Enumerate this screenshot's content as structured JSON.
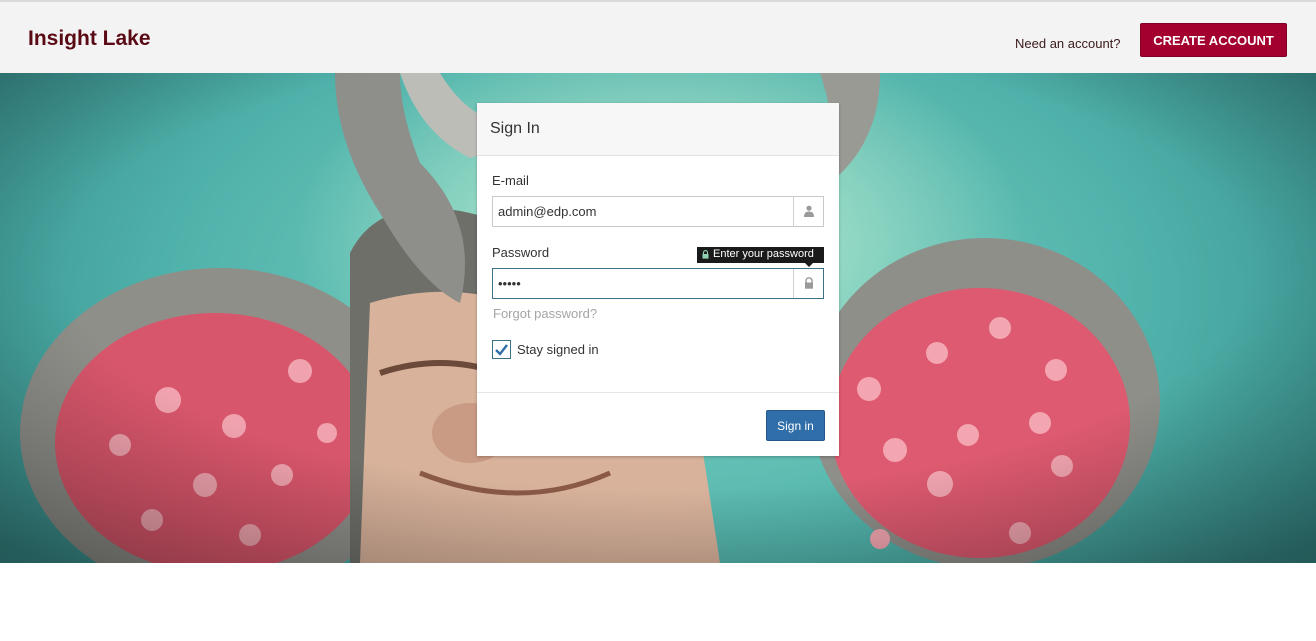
{
  "header": {
    "brand": "Insight Lake",
    "need_account": "Need an account?",
    "create_account_label": "CREATE ACCOUNT"
  },
  "signin": {
    "title": "Sign In",
    "email_label": "E-mail",
    "email_value": "admin@edp.com",
    "password_label": "Password",
    "password_value": "•••••",
    "password_tooltip": "Enter your password",
    "forgot_label": "Forgot password?",
    "stay_signed_in_label": "Stay signed in",
    "stay_signed_in_checked": true,
    "submit_label": "Sign in"
  },
  "icons": {
    "email_addon": "user-icon",
    "password_addon": "lock-icon",
    "tooltip_icon": "lock-icon",
    "checkbox_mark": "checkmark-icon"
  },
  "colors": {
    "brand": "#5a0a14",
    "create_button": "#a3002f",
    "signin_button": "#2f6ea8",
    "focus_border": "#3d6f86"
  }
}
